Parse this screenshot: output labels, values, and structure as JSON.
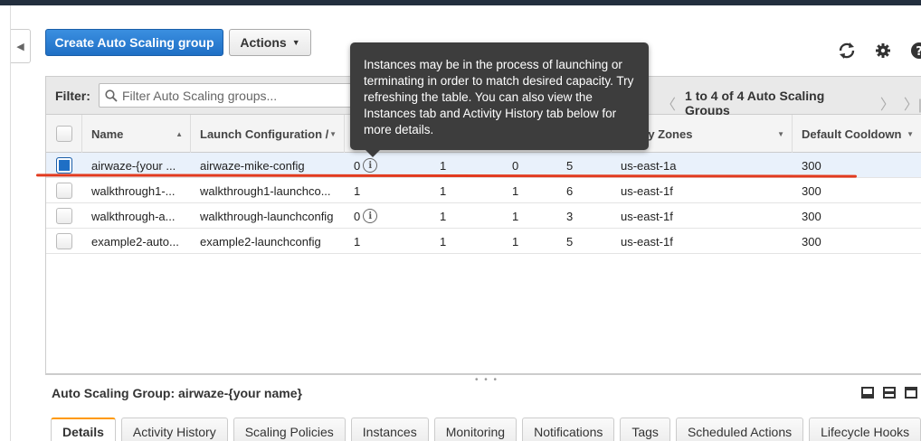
{
  "toolbar": {
    "create_label": "Create Auto Scaling group",
    "actions_label": "Actions",
    "icons": [
      "refresh-icon",
      "gear-icon",
      "help-icon"
    ]
  },
  "filter": {
    "label": "Filter:",
    "placeholder": "Filter Auto Scaling groups...",
    "pager_text": "1 to 4 of 4 Auto Scaling Groups"
  },
  "table": {
    "columns": [
      "Name",
      "Launch Configuration /",
      "ability Zones",
      "Default Cooldown"
    ],
    "rows": [
      {
        "name": "airwaze-{your ...",
        "launch_config": "airwaze-mike-config",
        "instances": "0",
        "info": true,
        "desired": "1",
        "min": "0",
        "max": "5",
        "zones": "us-east-1a",
        "cooldown": "300",
        "selected": true
      },
      {
        "name": "walkthrough1-...",
        "launch_config": "walkthrough1-launchco...",
        "instances": "1",
        "info": false,
        "desired": "1",
        "min": "1",
        "max": "6",
        "zones": "us-east-1f",
        "cooldown": "300",
        "selected": false
      },
      {
        "name": "walkthrough-a...",
        "launch_config": "walkthrough-launchconfig",
        "instances": "0",
        "info": true,
        "desired": "1",
        "min": "1",
        "max": "3",
        "zones": "us-east-1f",
        "cooldown": "300",
        "selected": false
      },
      {
        "name": "example2-auto...",
        "launch_config": "example2-launchconfig",
        "instances": "1",
        "info": false,
        "desired": "1",
        "min": "1",
        "max": "5",
        "zones": "us-east-1f",
        "cooldown": "300",
        "selected": false
      }
    ]
  },
  "tooltip": {
    "text": "Instances may be in the process of launching or terminating in order to match desired capacity. Try refreshing the table. You can also view the Instances tab and Activity History tab below for more details."
  },
  "details": {
    "title": "Auto Scaling Group: airwaze-{your name}",
    "tabs": [
      "Details",
      "Activity History",
      "Scaling Policies",
      "Instances",
      "Monitoring",
      "Notifications",
      "Tags",
      "Scheduled Actions",
      "Lifecycle Hooks"
    ],
    "active_tab": "Details"
  },
  "colors": {
    "primary": "#1f6fc5",
    "annotation": "#e23a1e",
    "tooltip_bg": "#3d3d3d",
    "active_tab_accent": "#ff9900"
  }
}
